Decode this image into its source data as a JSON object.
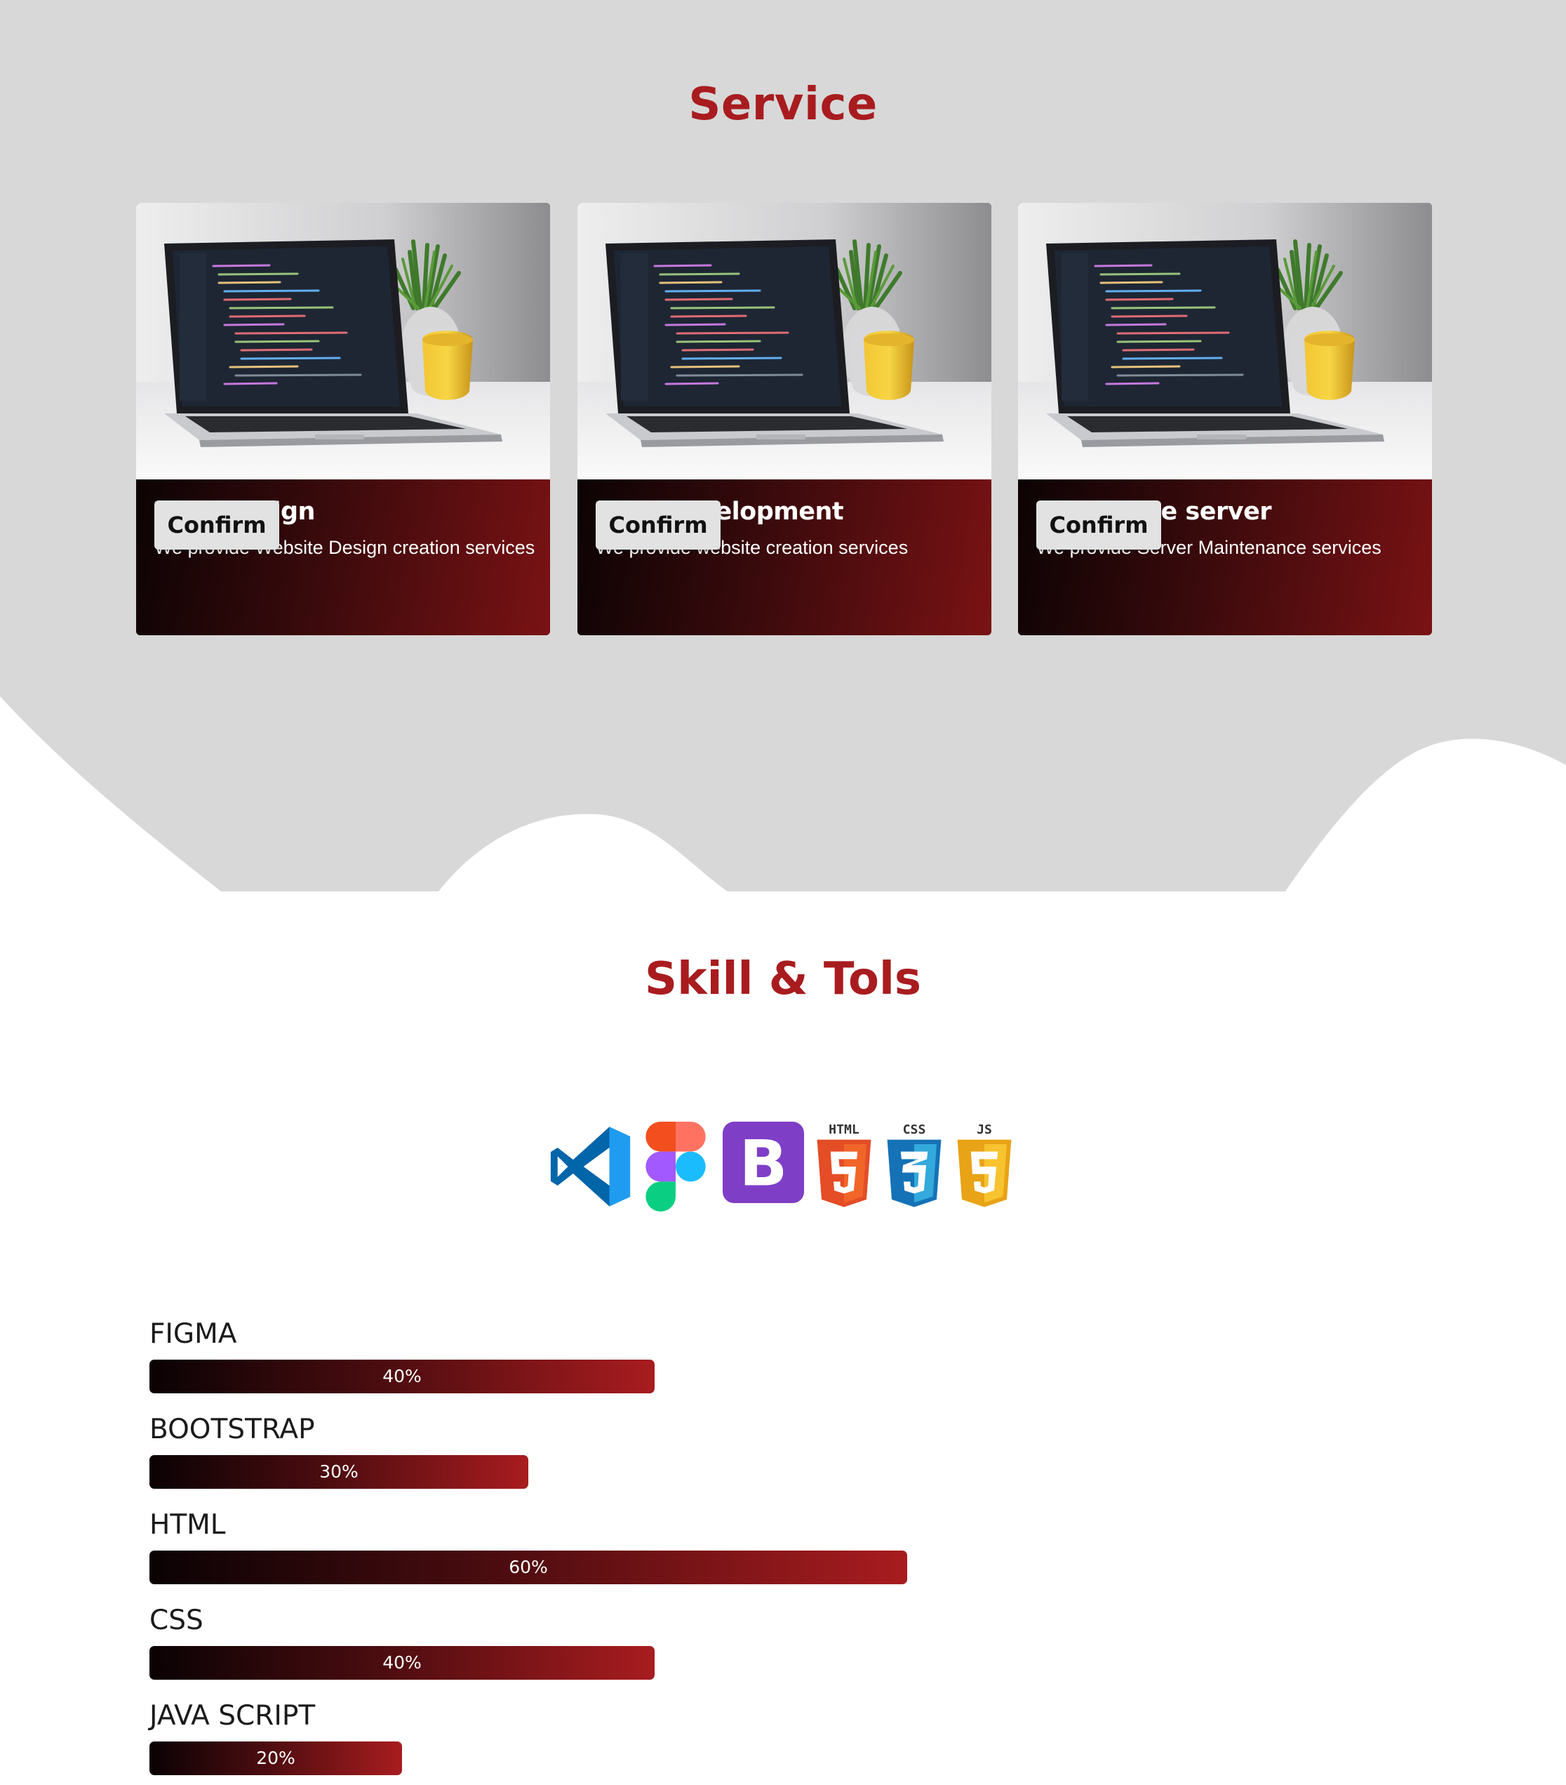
{
  "service": {
    "title": "Service",
    "cards": [
      {
        "title": "Web Design",
        "description": "We provide Website Design creation services",
        "button": "Confirm"
      },
      {
        "title": "Web Development",
        "description": "We provide website creation services",
        "button": "Confirm"
      },
      {
        "title": "Maintence server",
        "description": "We provide Server Maintenance services",
        "button": "Confirm"
      }
    ]
  },
  "skills": {
    "title": "Skill & Tols",
    "tools": [
      "vscode-icon",
      "figma-icon",
      "bootstrap-icon",
      "html5-icon",
      "css3-icon",
      "js-icon"
    ],
    "tool_labels": {
      "html": "HTML",
      "css": "CSS",
      "js": "JS",
      "bootstrap": "B"
    },
    "items": [
      {
        "name": "FIGMA",
        "percent": 40,
        "label": "40%"
      },
      {
        "name": "BOOTSTRAP",
        "percent": 30,
        "label": "30%"
      },
      {
        "name": "HTML",
        "percent": 60,
        "label": "60%"
      },
      {
        "name": "CSS",
        "percent": 40,
        "label": "40%"
      },
      {
        "name": "JAVA SCRIPT",
        "percent": 20,
        "label": "20%"
      }
    ]
  },
  "colors": {
    "accent": "#a81c1f",
    "service_bg": "#d8d8d8",
    "button_bg": "#e2e2e2"
  }
}
